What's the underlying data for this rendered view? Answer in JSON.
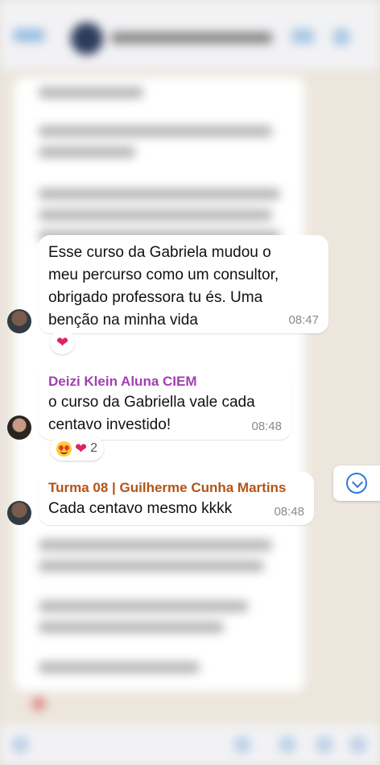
{
  "colors": {
    "sender_deizi": "#a23fb2",
    "sender_turma": "#b25418",
    "heart": "#e0245e",
    "accent": "#2f7ad9"
  },
  "messages": [
    {
      "text": "Esse curso da Gabriela mudou o\nmeu percurso como um consultor,\nobrigado professora tu és. Uma\nbenção na minha vida",
      "time": "08:47",
      "reactions": {
        "emoji": "heart",
        "count": ""
      }
    },
    {
      "sender": "Deizi Klein Aluna CIEM",
      "text": "o curso da Gabriella vale cada\ncentavo investido!",
      "time": "08:48",
      "reactions": {
        "emoji": "heart-eyes, heart",
        "count": "2"
      }
    },
    {
      "sender": "Turma 08 | Guilherme Cunha Martins",
      "text": "Cada centavo mesmo kkkk",
      "time": "08:48"
    }
  ],
  "icons": {
    "scroll": "chevron-down-circle-icon",
    "heart": "heart-icon",
    "heart_eyes": "heart-eyes-icon"
  }
}
